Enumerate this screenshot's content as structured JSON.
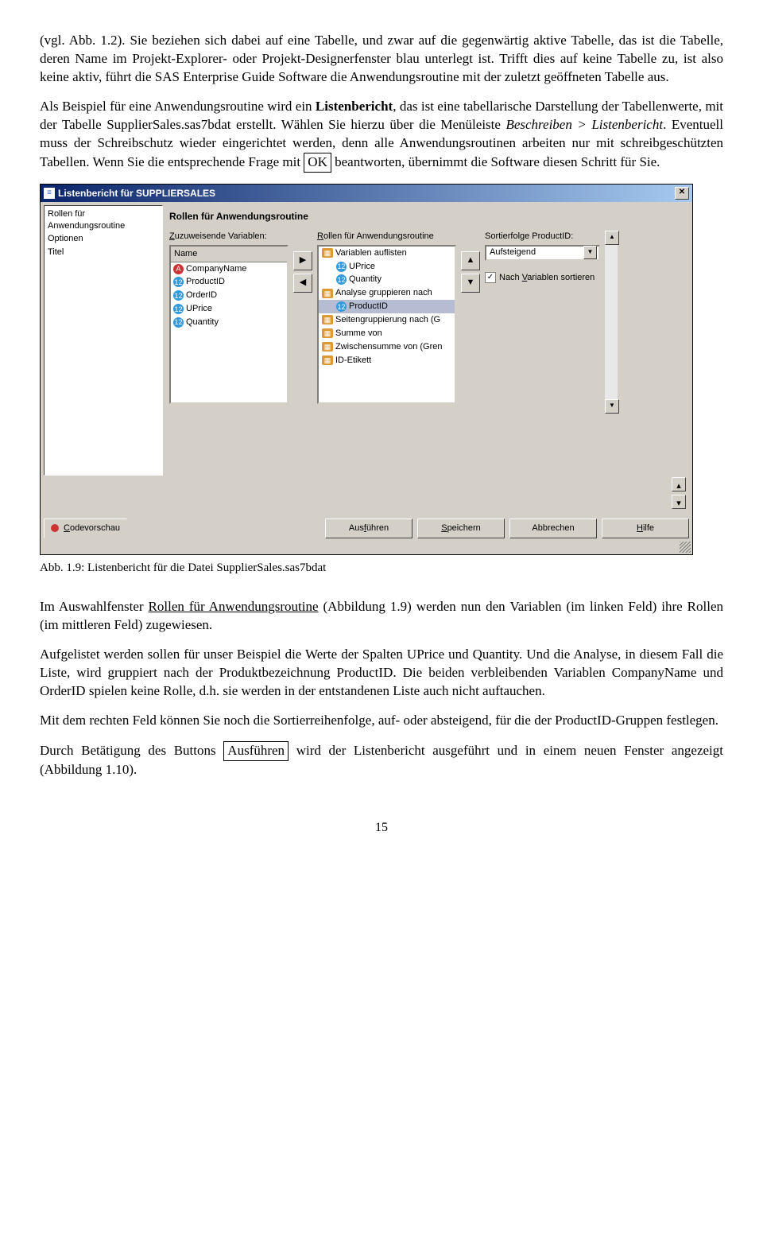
{
  "text": {
    "para1_a": "(vgl. Abb. 1.2). Sie beziehen sich dabei auf eine Tabelle, und zwar auf die gegenwärtig aktive Tabelle, das ist die Tabelle, deren Name im Projekt-Explorer- oder Projekt-Designerfenster blau unterlegt ist. Trifft dies auf keine Tabelle zu, ist also keine aktiv, führt die SAS Enterprise Guide Software die Anwendungsroutine mit der zuletzt geöffneten Tabelle aus.",
    "para2_a": "Als Beispiel für eine Anwendungsroutine wird ein ",
    "para2_bold1": "Listenbericht",
    "para2_b": ", das ist eine tabellarische Darstellung der Tabellenwerte, mit der Tabelle SupplierSales.sas7bdat erstellt. Wählen Sie hierzu über die Menüleiste ",
    "para2_it": "Beschreiben > Listenbericht",
    "para2_c": ". Eventuell muss der Schreibschutz wieder eingerichtet werden, denn alle Anwendungsroutinen arbeiten nur mit schreibgeschützten Tabellen. Wenn Sie die entsprechende Frage mit ",
    "para2_ok": "OK",
    "para2_d": " beantworten, übernimmt die Software diesen Schritt für Sie.",
    "caption": "Abb. 1.9: Listenbericht für die Datei SupplierSales.sas7bdat",
    "para3_a": "Im Auswahlfenster ",
    "para3_u": "Rollen für Anwendungsroutine",
    "para3_b": " (Abbildung 1.9) werden nun den Variablen (im linken Feld) ihre Rollen (im mittleren Feld) zugewiesen.",
    "para4": "Aufgelistet werden sollen für unser Beispiel die Werte der Spalten UPrice und Quantity. Und die Analyse, in diesem Fall die Liste, wird gruppiert nach der Produktbezeichnung ProductID. Die beiden verbleibenden Variablen CompanyName und OrderID spielen keine Rolle, d.h. sie werden in der entstandenen Liste auch nicht auftauchen.",
    "para5": "Mit dem rechten Feld können Sie noch die Sortierreihenfolge, auf- oder absteigend, für die der ProductID-Gruppen festlegen.",
    "para6_a": "Durch Betätigung des Buttons ",
    "para6_btn": "Ausführen",
    "para6_b": " wird der Listenbericht ausgeführt und in einem neuen Fenster angezeigt (Abbildung 1.10).",
    "pagenum": "15"
  },
  "window": {
    "title": "Listenbericht für SUPPLIERSALES",
    "nav": [
      "Rollen für Anwendungsroutine",
      "Optionen",
      "Titel"
    ],
    "heading": "Rollen für Anwendungsroutine",
    "labels": {
      "assign": "Zuzuweisende Variablen:",
      "roles": "Rollen  für Anwendungsroutine",
      "sort": "Sortierfolge ProductID:",
      "name_header": "Name",
      "sortvalue": "Aufsteigend",
      "sort_checkbox_pre": "Nach ",
      "sort_checkbox_accel": "V",
      "sort_checkbox_post": "ariablen sortieren"
    },
    "vars": [
      {
        "icon": "text",
        "label": "CompanyName"
      },
      {
        "icon": "num",
        "label": "ProductID"
      },
      {
        "icon": "num",
        "label": "OrderID"
      },
      {
        "icon": "num",
        "label": "UPrice"
      },
      {
        "icon": "num",
        "label": "Quantity"
      }
    ],
    "roles": [
      {
        "icon": "grp",
        "indent": 0,
        "label": "Variablen auflisten",
        "sel": false
      },
      {
        "icon": "num",
        "indent": 1,
        "label": "UPrice",
        "sel": false
      },
      {
        "icon": "num",
        "indent": 1,
        "label": "Quantity",
        "sel": false
      },
      {
        "icon": "grp",
        "indent": 0,
        "label": "Analyse gruppieren nach",
        "sel": false
      },
      {
        "icon": "num",
        "indent": 1,
        "label": "ProductID",
        "sel": true
      },
      {
        "icon": "grp",
        "indent": 0,
        "label": "Seitengruppierung nach (G",
        "sel": false
      },
      {
        "icon": "grp",
        "indent": 0,
        "label": "Summe von",
        "sel": false
      },
      {
        "icon": "grp",
        "indent": 0,
        "label": "Zwischensumme von (Gren",
        "sel": false
      },
      {
        "icon": "grp",
        "indent": 0,
        "label": "ID-Etikett",
        "sel": false
      }
    ],
    "footer": {
      "codeprev_accel": "C",
      "codeprev_rest": "odevorschau",
      "run": "Ausführen",
      "run_accel": "f",
      "save": "Speichern",
      "save_accel": "S",
      "cancel": "Abbrechen",
      "help": "Hilfe",
      "help_accel": "H"
    }
  }
}
